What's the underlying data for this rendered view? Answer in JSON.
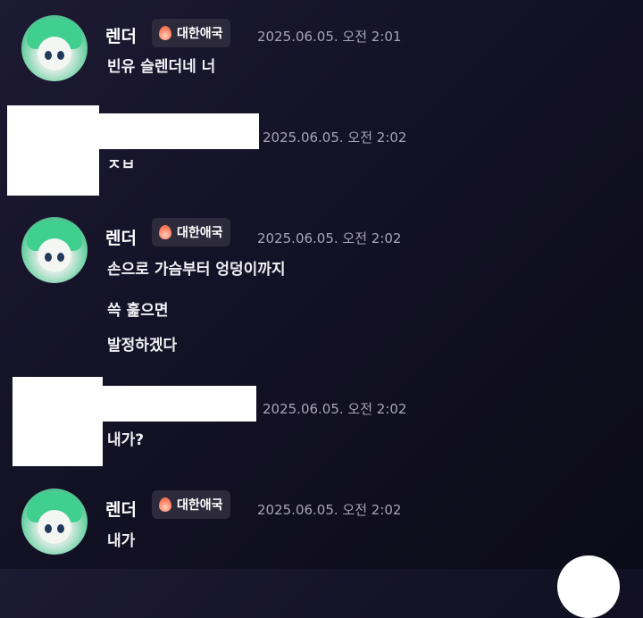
{
  "messages": [
    {
      "author": "렌더",
      "badge": "대한애국",
      "timestamp": "2025.06.05. 오전 2:01",
      "lines": [
        "빈유 슬렌더네 너"
      ]
    },
    {
      "timestamp": "2025.06.05. 오전 2:02",
      "lines": [
        "ㅈㅂ"
      ]
    },
    {
      "author": "렌더",
      "badge": "대한애국",
      "timestamp": "2025.06.05. 오전 2:02",
      "lines": [
        "손으로 가슴부터 엉덩이까지",
        "쓱 훑으면",
        "발정하겠다"
      ]
    },
    {
      "timestamp": "2025.06.05. 오전 2:02",
      "lines": [
        "내가?"
      ]
    },
    {
      "author": "렌더",
      "badge": "대한애국",
      "timestamp": "2025.06.05. 오전 2:02",
      "lines": [
        "내가"
      ]
    }
  ],
  "icons": {
    "avatar": "anime-avatar-green-hair",
    "badge_icon": "fire-icon"
  }
}
